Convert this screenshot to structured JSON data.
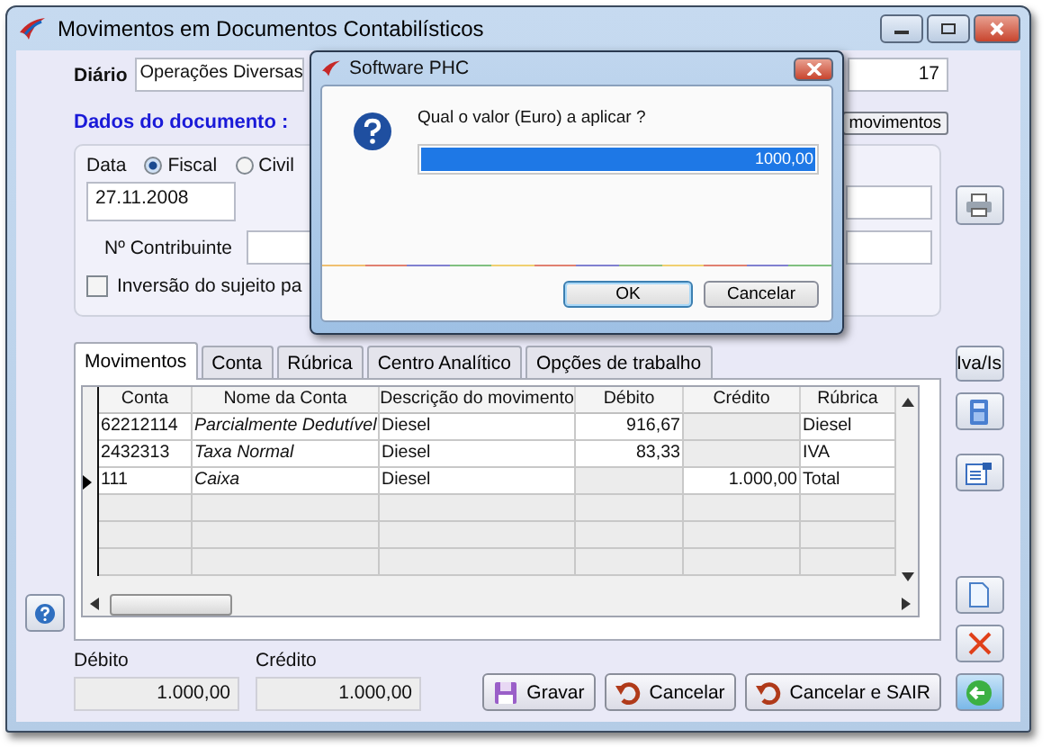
{
  "window": {
    "title": "Movimentos em Documentos Contabilísticos"
  },
  "diario": {
    "label": "Diário",
    "value": "Operações Diversas",
    "number": "17"
  },
  "section_title": "Dados do documento :",
  "movimentos_button": "movimentos",
  "document": {
    "date_label": "Data",
    "date_types": [
      {
        "label": "Fiscal",
        "selected": true
      },
      {
        "label": "Civil",
        "selected": false
      }
    ],
    "date": "27.11.2008",
    "contribuinte_label": "Nº Contribuinte",
    "inversao": {
      "label": "Inversão do sujeito pa",
      "checked": false
    }
  },
  "tabs": [
    {
      "label": "Movimentos",
      "selected": true
    },
    {
      "label": "Conta",
      "selected": false
    },
    {
      "label": "Rúbrica",
      "selected": false
    },
    {
      "label": "Centro Analítico",
      "selected": false
    },
    {
      "label": "Opções de trabalho",
      "selected": false
    }
  ],
  "table": {
    "columns": [
      "Conta",
      "Nome da Conta",
      "Descrição do movimento",
      "Débito",
      "Crédito",
      "Rúbrica"
    ],
    "rows": [
      {
        "cells": [
          "62212114",
          "Parcialmente Dedutível",
          "Diesel",
          "916,67",
          "",
          "Diesel"
        ],
        "current": false
      },
      {
        "cells": [
          "2432313",
          "Taxa Normal",
          "Diesel",
          "83,33",
          "",
          "IVA"
        ],
        "current": false
      },
      {
        "cells": [
          "111",
          "Caixa",
          "Diesel",
          "",
          "1.000,00",
          "Total"
        ],
        "current": true
      }
    ]
  },
  "side_button": "Iva/Is",
  "totals": [
    {
      "label": "Débito",
      "value": "1.000,00"
    },
    {
      "label": "Crédito",
      "value": "1.000,00"
    }
  ],
  "actions": [
    {
      "kind": "save",
      "label": "Gravar"
    },
    {
      "kind": "undo",
      "label": "Cancelar"
    },
    {
      "kind": "undo",
      "label": "Cancelar e SAIR"
    }
  ],
  "dialog": {
    "title": "Software PHC",
    "prompt": "Qual o valor (Euro) a aplicar ?",
    "value": "1000,00",
    "buttons": [
      {
        "label": "OK",
        "default": true
      },
      {
        "label": "Cancelar",
        "default": false
      }
    ]
  }
}
